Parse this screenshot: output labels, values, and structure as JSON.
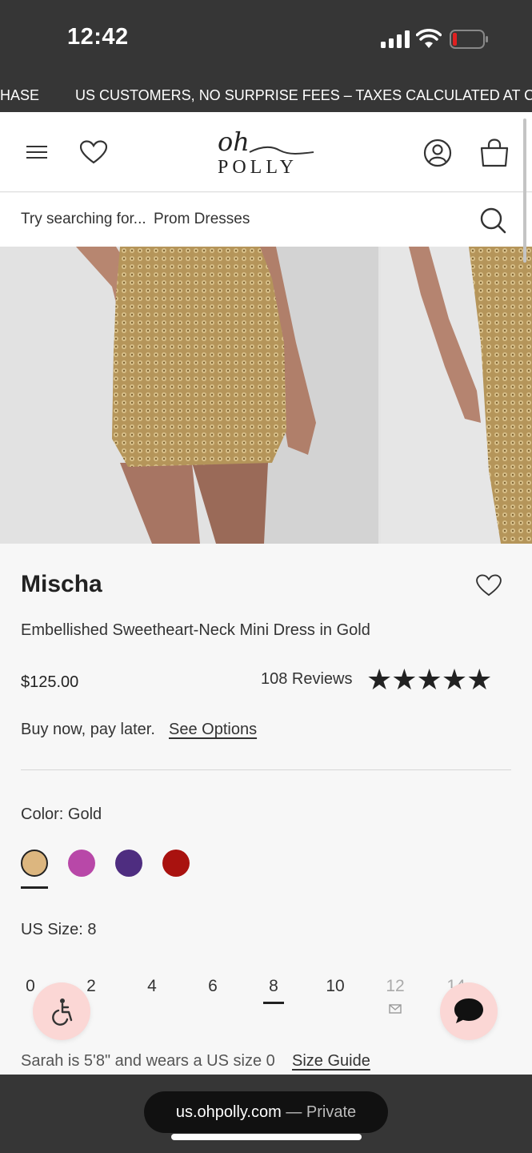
{
  "status_bar": {
    "time": "12:42"
  },
  "ticker": {
    "left_fragment": "HASE",
    "message": "US CUSTOMERS, NO SURPRISE FEES – TAXES CALCULATED AT CHEC"
  },
  "header": {
    "logo_script": "oh",
    "logo_brand": "POLLY"
  },
  "search": {
    "placeholder": "Try searching for...",
    "term": "Prom Dresses"
  },
  "product": {
    "name": "Mischa",
    "description": "Embellished Sweetheart-Neck Mini Dress in Gold",
    "price": "$125.00",
    "reviews_label": "108 Reviews",
    "rating_stars": "★★★★★",
    "rating": 5,
    "bnpl_text": "Buy now, pay later.",
    "bnpl_link": "See Options",
    "color_label": "Color: Gold",
    "swatches": [
      {
        "name": "Gold",
        "hex": "#dcb67f",
        "selected": true
      },
      {
        "name": "Pink",
        "hex": "#b848a8",
        "selected": false
      },
      {
        "name": "Purple",
        "hex": "#4e2d80",
        "selected": false
      },
      {
        "name": "Red",
        "hex": "#a9120f",
        "selected": false
      }
    ],
    "size_label": "US Size:  8",
    "sizes": [
      "0",
      "2",
      "4",
      "6",
      "8",
      "10",
      "12",
      "14"
    ],
    "selected_size": "8",
    "model_note": "Sarah is 5'8\" and wears a US size 0",
    "size_guide": "Size Guide"
  },
  "browser": {
    "domain": "us.ohpolly.com",
    "mode": "— Private"
  },
  "colors": {
    "dark_bar": "#363636",
    "fab_bg": "#fbd7d5",
    "accent": "#222222"
  }
}
